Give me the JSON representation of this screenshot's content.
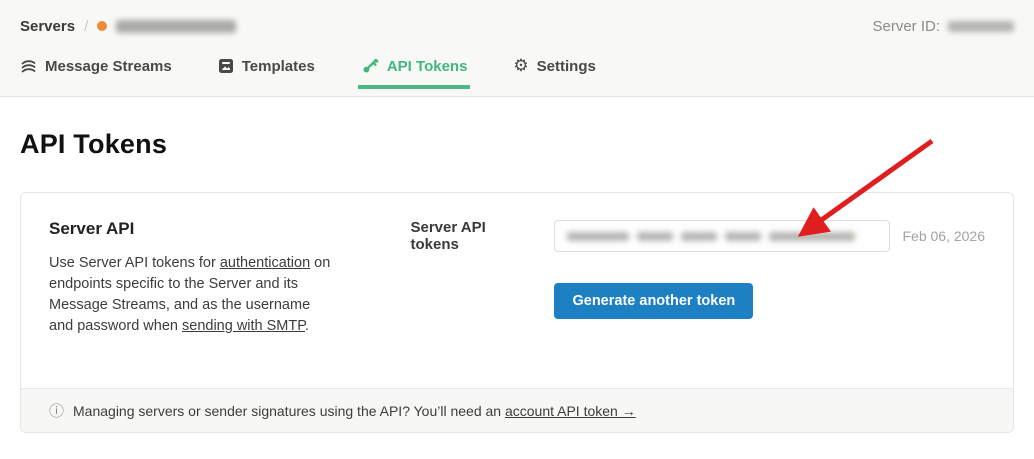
{
  "colors": {
    "accent_green": "#3fb77e",
    "button_blue": "#1d80c3",
    "breadcrumb_dot_orange": "#f08b33",
    "annotation_arrow_red": "#e01e1e",
    "header_background": "#f8f8f7"
  },
  "breadcrumb": {
    "root": "Servers",
    "separator": "/"
  },
  "server_id_label": "Server ID:",
  "tabs": [
    {
      "label": "Message Streams",
      "icon": "message-streams-icon",
      "active": false
    },
    {
      "label": "Templates",
      "icon": "templates-icon",
      "active": false
    },
    {
      "label": "API Tokens",
      "icon": "key-icon",
      "active": true
    },
    {
      "label": "Settings",
      "icon": "gear-icon",
      "active": false
    }
  ],
  "page_title": "API Tokens",
  "card": {
    "section_title": "Server API",
    "description": {
      "part1": "Use Server API tokens for ",
      "link1": "authentication",
      "part2": " on endpoints specific to the Server and its Message Streams, and as the username and password when ",
      "link2": "sending with SMTP",
      "part3": "."
    },
    "tokens_label": "Server API tokens",
    "token_created_date": "Feb 06, 2026",
    "generate_button_label": "Generate another token"
  },
  "footer_note": {
    "icon": "info-icon",
    "text_before_link": "Managing servers or sender signatures using the API? You’ll need an ",
    "link_label": "account API token →"
  }
}
